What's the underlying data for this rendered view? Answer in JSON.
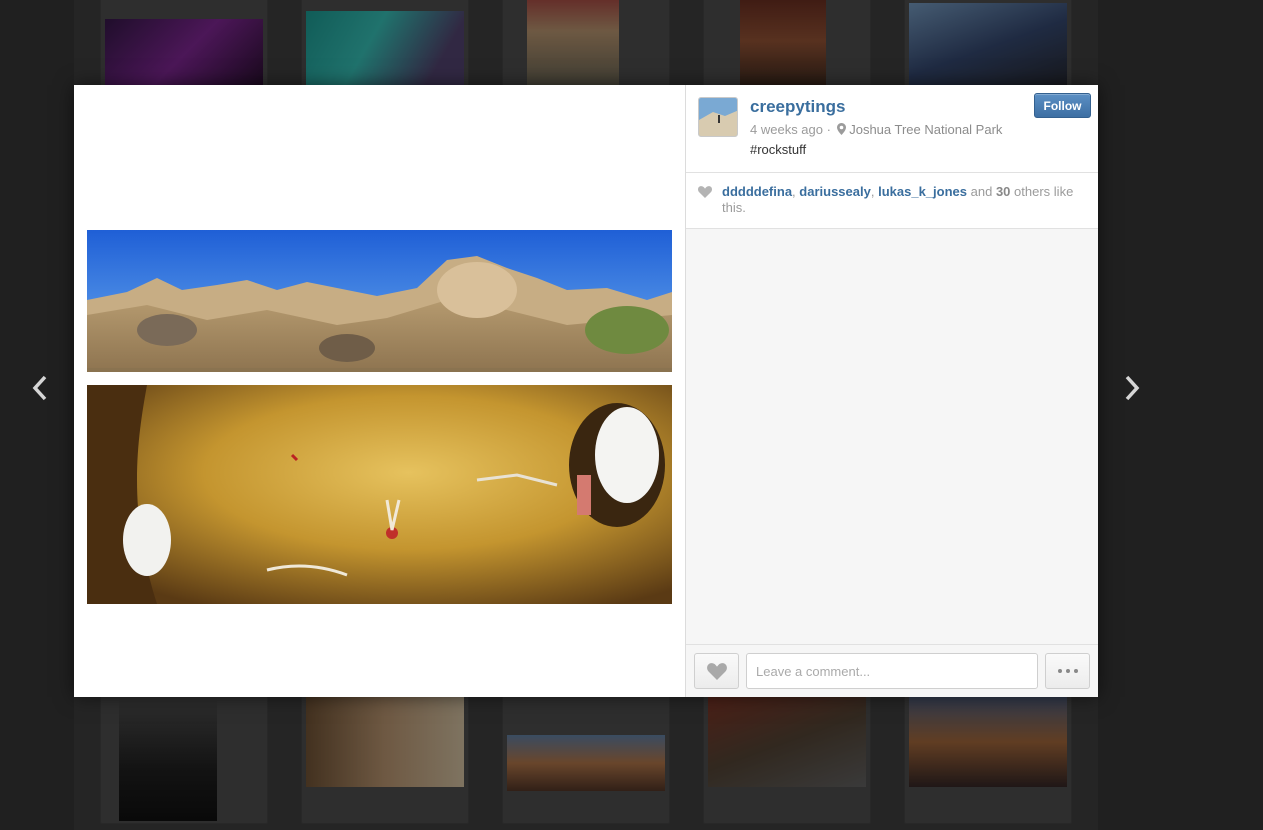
{
  "post": {
    "username": "creepytings",
    "time": "4 weeks ago",
    "separator": "·",
    "location": "Joshua Tree National Park",
    "caption": "#rockstuff",
    "follow_label": "Follow"
  },
  "likes": {
    "users": [
      "dddddefina",
      "dariussealy",
      "lukas_k_jones"
    ],
    "sep": ",",
    "and": "and",
    "count": "30",
    "tail_1": "others",
    "tail_2": "like this."
  },
  "comment": {
    "placeholder": "Leave a comment..."
  },
  "icons": {
    "prev": "chevron-left-icon",
    "next": "chevron-right-icon",
    "like": "heart-icon",
    "location": "location-pin-icon",
    "more": "ellipsis-icon"
  },
  "colors": {
    "link": "#3a6e9e",
    "follow_button": "#3d6fa3",
    "backdrop": "#3b3b3b"
  }
}
